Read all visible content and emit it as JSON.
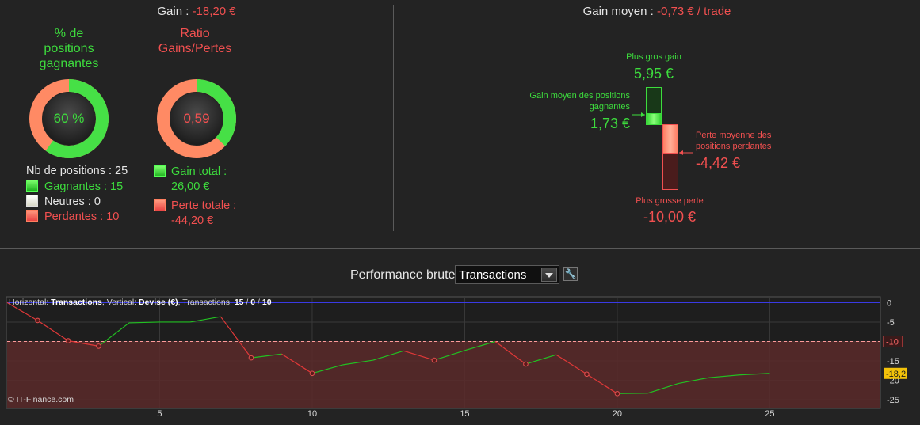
{
  "summary": {
    "gain_label": "Gain : ",
    "gain_value": "-18,20 €",
    "win_ring": {
      "label_lines": [
        "% de",
        "positions",
        "gagnantes"
      ],
      "value": "60 %",
      "fraction": 0.6
    },
    "ratio_ring": {
      "label_lines": [
        "Ratio",
        "Gains/Pertes"
      ],
      "value": "0,59",
      "fraction": 0.371
    },
    "positions_total": "Nb de positions : 25",
    "winning": "Gagnantes : 15",
    "neutral": "Neutres : 0",
    "losing": "Perdantes : 10",
    "total_gain_lines": [
      "Gain total :",
      "26,00 €"
    ],
    "total_loss_lines": [
      "Perte totale :",
      "-44,20 €"
    ]
  },
  "average": {
    "label": "Gain moyen : ",
    "value": "-0,73 € / trade",
    "biggest_gain_label": "Plus gros gain",
    "biggest_gain_value": "5,95 €",
    "avg_win_label_lines": [
      "Gain moyen des positions",
      "gagnantes"
    ],
    "avg_win_value": "1,73 €",
    "avg_loss_label_lines": [
      "Perte moyenne des",
      "positions perdantes"
    ],
    "avg_loss_value": "-4,42 €",
    "biggest_loss_label": "Plus grosse perte",
    "biggest_loss_value": "-10,00 €"
  },
  "performance": {
    "title": "Performance brute",
    "selected": "Transactions"
  },
  "chart_info": {
    "horizontal_label": "Horizontal: ",
    "horizontal_value": "Transactions",
    "vertical_label": ", Vertical: ",
    "vertical_value": "Devise (€)",
    "transactions_label": ", Transactions: ",
    "wins": "15",
    "neutral": "0",
    "losses": "10",
    "sep": " / "
  },
  "copyright": "© IT-Finance.com",
  "chart_data": {
    "type": "line",
    "x": [
      0,
      1,
      2,
      3,
      4,
      5,
      6,
      7,
      8,
      9,
      10,
      11,
      12,
      13,
      14,
      15,
      16,
      17,
      18,
      19,
      20,
      21,
      22,
      23,
      24,
      25
    ],
    "y": [
      0,
      -4.6,
      -9.8,
      -11.2,
      -5.2,
      -5.0,
      -5.0,
      -3.6,
      -14.2,
      -13.2,
      -18.2,
      -16.0,
      -14.8,
      -12.4,
      -14.8,
      -12.3,
      -10.0,
      -15.8,
      -13.4,
      -18.4,
      -23.4,
      -23.3,
      -20.8,
      -19.3,
      -18.6,
      -18.2
    ],
    "outcome": [
      "start",
      "loss",
      "loss",
      "loss",
      "win",
      "win",
      "win",
      "win",
      "loss",
      "win",
      "loss",
      "win",
      "win",
      "win",
      "loss",
      "win",
      "win",
      "loss",
      "win",
      "loss",
      "loss",
      "win",
      "win",
      "win",
      "win",
      "win"
    ],
    "xlim": [
      0,
      28.6
    ],
    "ylim": [
      -27,
      1.3
    ],
    "x_ticks": [
      5,
      10,
      15,
      20,
      25
    ],
    "y_ticks": [
      0,
      -5,
      -10,
      -15,
      -20,
      -25
    ],
    "y_tick_labels": [
      "0",
      "-5",
      "-10",
      "-15",
      "-20",
      "-25"
    ],
    "reference_zero": 0,
    "reference_max_loss": -10,
    "max_loss_label": "-10",
    "last_value_label": "-18,2",
    "last_value": -18.2,
    "colors": {
      "win": "#22c022",
      "loss": "#e03838",
      "zero_line": "#3b3bff",
      "loss_zone": "#5a2a2a",
      "marker_fill": "#5a1a1a",
      "last_badge": "#f2c20a"
    }
  }
}
